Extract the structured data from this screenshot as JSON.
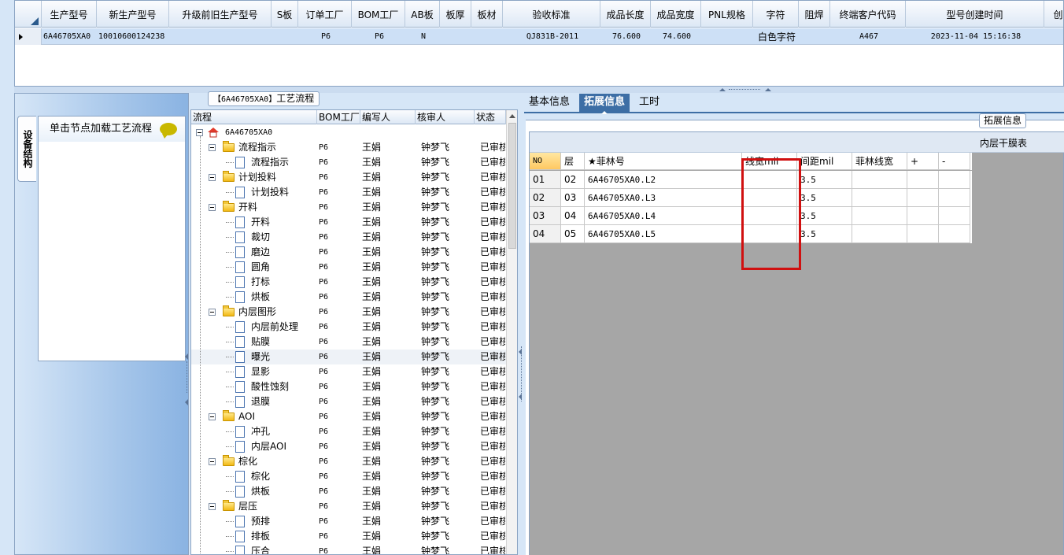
{
  "top_grid": {
    "columns": [
      "生产型号",
      "新生产型号",
      "升级前旧生产型号",
      "S板",
      "订单工厂",
      "BOM工厂",
      "AB板",
      "板厚",
      "板材",
      "验收标准",
      "成品长度",
      "成品宽度",
      "PNL规格",
      "字符",
      "阻焊",
      "终端客户代码",
      "型号创建时间",
      "创建人"
    ],
    "row": [
      "6A46705XA0",
      "10010600124238",
      "",
      "",
      "P6",
      "P6",
      "N",
      "",
      "",
      "QJ831B-2011",
      "76.600",
      "74.600",
      "",
      "白色字符",
      "",
      "A467",
      "2023-11-04 15:16:38",
      ""
    ]
  },
  "left_panel": {
    "vertical_tab": "设备结构",
    "hint": "单击节点加载工艺流程",
    "hint_icon": "speech-bubble-icon"
  },
  "process": {
    "title_code": "【6A46705XA0】",
    "title_text": "工艺流程",
    "columns": [
      "流程",
      "BOM工厂",
      "编写人",
      "核审人",
      "状态"
    ],
    "root": "6A46705XA0",
    "rows": [
      {
        "name": "流程指示",
        "level": 1,
        "type": "folder",
        "bom": "P6",
        "writer": "王娟",
        "checker": "钟梦飞",
        "status": "已审核"
      },
      {
        "name": "流程指示",
        "level": 2,
        "type": "doc",
        "bom": "P6",
        "writer": "王娟",
        "checker": "钟梦飞",
        "status": "已审核"
      },
      {
        "name": "计划投料",
        "level": 1,
        "type": "folder",
        "bom": "P6",
        "writer": "王娟",
        "checker": "钟梦飞",
        "status": "已审核"
      },
      {
        "name": "计划投料",
        "level": 2,
        "type": "doc",
        "bom": "P6",
        "writer": "王娟",
        "checker": "钟梦飞",
        "status": "已审核"
      },
      {
        "name": "开料",
        "level": 1,
        "type": "folder",
        "bom": "P6",
        "writer": "王娟",
        "checker": "钟梦飞",
        "status": "已审核"
      },
      {
        "name": "开料",
        "level": 2,
        "type": "doc",
        "bom": "P6",
        "writer": "王娟",
        "checker": "钟梦飞",
        "status": "已审核"
      },
      {
        "name": "裁切",
        "level": 2,
        "type": "doc",
        "bom": "P6",
        "writer": "王娟",
        "checker": "钟梦飞",
        "status": "已审核"
      },
      {
        "name": "磨边",
        "level": 2,
        "type": "doc",
        "bom": "P6",
        "writer": "王娟",
        "checker": "钟梦飞",
        "status": "已审核"
      },
      {
        "name": "圆角",
        "level": 2,
        "type": "doc",
        "bom": "P6",
        "writer": "王娟",
        "checker": "钟梦飞",
        "status": "已审核"
      },
      {
        "name": "打标",
        "level": 2,
        "type": "doc",
        "bom": "P6",
        "writer": "王娟",
        "checker": "钟梦飞",
        "status": "已审核"
      },
      {
        "name": "烘板",
        "level": 2,
        "type": "doc",
        "bom": "P6",
        "writer": "王娟",
        "checker": "钟梦飞",
        "status": "已审核"
      },
      {
        "name": "内层图形",
        "level": 1,
        "type": "folder",
        "bom": "P6",
        "writer": "王娟",
        "checker": "钟梦飞",
        "status": "已审核"
      },
      {
        "name": "内层前处理",
        "level": 2,
        "type": "doc",
        "bom": "P6",
        "writer": "王娟",
        "checker": "钟梦飞",
        "status": "已审核"
      },
      {
        "name": "贴膜",
        "level": 2,
        "type": "doc",
        "bom": "P6",
        "writer": "王娟",
        "checker": "钟梦飞",
        "status": "已审核"
      },
      {
        "name": "曝光",
        "level": 2,
        "type": "doc",
        "bom": "P6",
        "writer": "王娟",
        "checker": "钟梦飞",
        "status": "已审核",
        "selected": true
      },
      {
        "name": "显影",
        "level": 2,
        "type": "doc",
        "bom": "P6",
        "writer": "王娟",
        "checker": "钟梦飞",
        "status": "已审核"
      },
      {
        "name": "酸性蚀刻",
        "level": 2,
        "type": "doc",
        "bom": "P6",
        "writer": "王娟",
        "checker": "钟梦飞",
        "status": "已审核"
      },
      {
        "name": "退膜",
        "level": 2,
        "type": "doc",
        "bom": "P6",
        "writer": "王娟",
        "checker": "钟梦飞",
        "status": "已审核"
      },
      {
        "name": "AOI",
        "level": 1,
        "type": "folder",
        "bom": "P6",
        "writer": "王娟",
        "checker": "钟梦飞",
        "status": "已审核"
      },
      {
        "name": "冲孔",
        "level": 2,
        "type": "doc",
        "bom": "P6",
        "writer": "王娟",
        "checker": "钟梦飞",
        "status": "已审核"
      },
      {
        "name": "内层AOI",
        "level": 2,
        "type": "doc",
        "bom": "P6",
        "writer": "王娟",
        "checker": "钟梦飞",
        "status": "已审核"
      },
      {
        "name": "棕化",
        "level": 1,
        "type": "folder",
        "bom": "P6",
        "writer": "王娟",
        "checker": "钟梦飞",
        "status": "已审核"
      },
      {
        "name": "棕化",
        "level": 2,
        "type": "doc",
        "bom": "P6",
        "writer": "王娟",
        "checker": "钟梦飞",
        "status": "已审核"
      },
      {
        "name": "烘板",
        "level": 2,
        "type": "doc",
        "bom": "P6",
        "writer": "王娟",
        "checker": "钟梦飞",
        "status": "已审核"
      },
      {
        "name": "层压",
        "level": 1,
        "type": "folder",
        "bom": "P6",
        "writer": "王娟",
        "checker": "钟梦飞",
        "status": "已审核"
      },
      {
        "name": "预排",
        "level": 2,
        "type": "doc",
        "bom": "P6",
        "writer": "王娟",
        "checker": "钟梦飞",
        "status": "已审核"
      },
      {
        "name": "排板",
        "level": 2,
        "type": "doc",
        "bom": "P6",
        "writer": "王娟",
        "checker": "钟梦飞",
        "status": "已审核"
      },
      {
        "name": "压合",
        "level": 2,
        "type": "doc",
        "bom": "P6",
        "writer": "王娟",
        "checker": "钟梦飞",
        "status": "已审核"
      }
    ]
  },
  "right_panel": {
    "tabs": [
      "基本信息",
      "拓展信息",
      "工时"
    ],
    "active_tab": "拓展信息",
    "group_label": "拓展信息",
    "inner_caption": "内层干膜表",
    "columns": [
      "NO",
      "层",
      "★菲林号",
      "线宽mil",
      "间距mil",
      "菲林线宽",
      "+",
      "-"
    ],
    "rows": [
      [
        "01",
        "02",
        "6A46705XA0.L2",
        "",
        "3.5",
        "",
        "",
        ""
      ],
      [
        "02",
        "03",
        "6A46705XA0.L3",
        "",
        "3.5",
        "",
        "",
        ""
      ],
      [
        "03",
        "04",
        "6A46705XA0.L4",
        "",
        "3.5",
        "",
        "",
        ""
      ],
      [
        "04",
        "05",
        "6A46705XA0.L5",
        "",
        "3.5",
        "",
        "",
        ""
      ]
    ]
  },
  "colors": {
    "accent": "#3d6ea5",
    "highlight": "#d01010",
    "panel_bg": "#d6e6f7"
  }
}
